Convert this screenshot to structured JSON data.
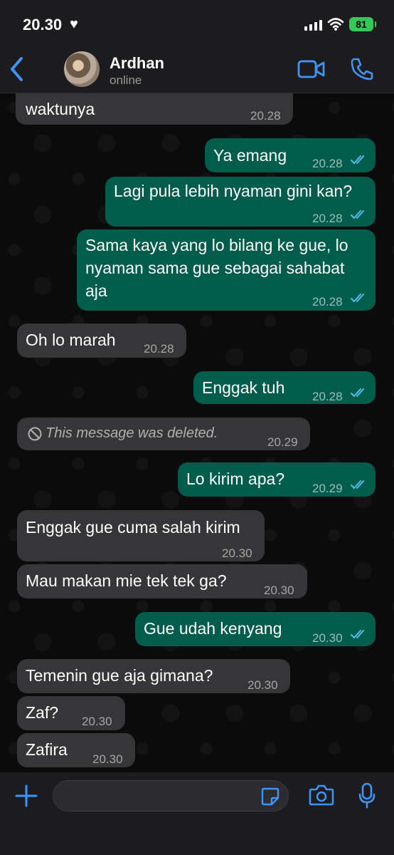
{
  "status_bar": {
    "time": "20.30",
    "battery": "81"
  },
  "header": {
    "contact_name": "Ardhan",
    "contact_status": "online"
  },
  "messages": [
    {
      "dir": "in",
      "text": "waktunya",
      "time": "20.28"
    },
    {
      "dir": "out",
      "text": "Ya emang",
      "time": "20.28",
      "read": true
    },
    {
      "dir": "out",
      "text": "Lagi pula lebih nyaman gini kan?",
      "time": "20.28",
      "read": true
    },
    {
      "dir": "out",
      "lines": [
        "Sama kaya yang lo bilang ke gue, lo",
        "nyaman sama gue sebagai sahabat",
        "aja"
      ],
      "time": "20.28",
      "read": true
    },
    {
      "dir": "in",
      "text": "Oh lo marah",
      "time": "20.28"
    },
    {
      "dir": "out",
      "text": "Enggak tuh",
      "time": "20.28",
      "read": true
    },
    {
      "dir": "in",
      "text": "This message was deleted.",
      "time": "20.29",
      "deleted": true
    },
    {
      "dir": "out",
      "text": "Lo kirim apa?",
      "time": "20.29",
      "read": true
    },
    {
      "dir": "in",
      "text": "Enggak gue cuma salah kirim",
      "time": "20.30"
    },
    {
      "dir": "in",
      "text": "Mau makan mie tek tek ga?",
      "time": "20.30"
    },
    {
      "dir": "out",
      "text": "Gue udah kenyang",
      "time": "20.30",
      "read": true
    },
    {
      "dir": "in",
      "text": "Temenin gue aja gimana?",
      "time": "20.30"
    },
    {
      "dir": "in",
      "text": "Zaf?",
      "time": "20.30"
    },
    {
      "dir": "in",
      "text": "Zafira",
      "time": "20.30"
    }
  ],
  "input": {
    "placeholder": ""
  },
  "colors": {
    "accent": "#3e94f7",
    "outgoing_bubble": "#005c4b",
    "incoming_bubble": "#363638",
    "read_ticks": "#53bdeb"
  },
  "icons": [
    "back-chevron-icon",
    "video-call-icon",
    "phone-icon",
    "plus-icon",
    "sticker-icon",
    "camera-icon",
    "microphone-icon",
    "read-ticks-icon",
    "deleted-icon"
  ]
}
